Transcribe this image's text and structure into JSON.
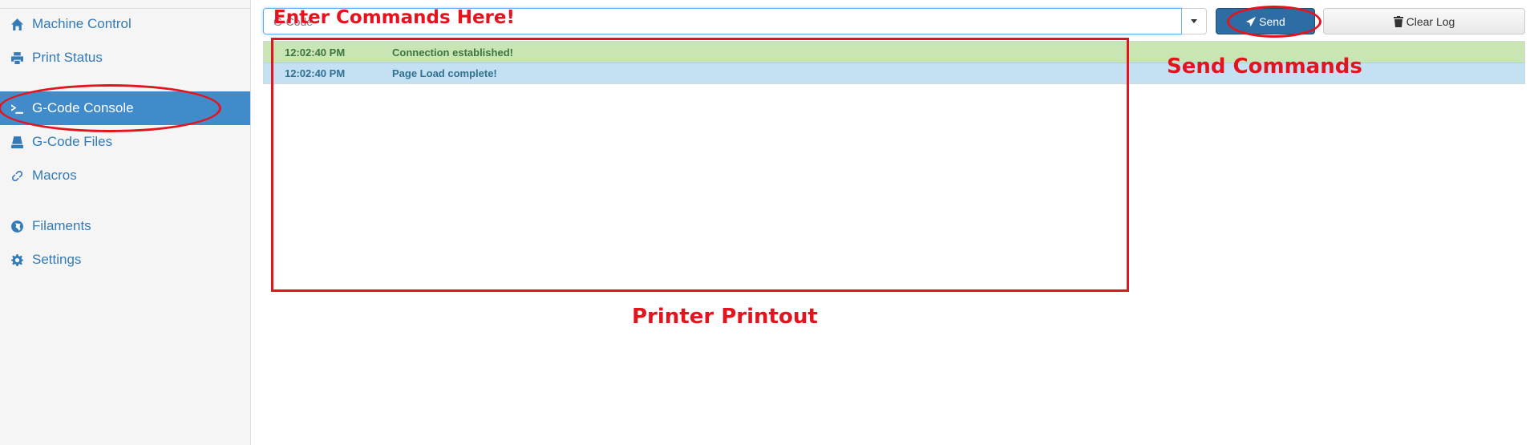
{
  "sidebar": {
    "items": [
      {
        "label": "Machine Control",
        "icon": "home-icon"
      },
      {
        "label": "Print Status",
        "icon": "printer-icon"
      },
      {
        "label": "G-Code Console",
        "icon": "terminal-icon",
        "active": true
      },
      {
        "label": "G-Code Files",
        "icon": "hdd-icon"
      },
      {
        "label": "Macros",
        "icon": "link-icon"
      },
      {
        "label": "Filaments",
        "icon": "globe-icon"
      },
      {
        "label": "Settings",
        "icon": "gear-icon"
      }
    ]
  },
  "toolbar": {
    "input_placeholder": "G-Code",
    "send_label": "Send",
    "clear_label": "Clear Log"
  },
  "log": [
    {
      "time": "12:02:40 PM",
      "message": "Connection established!",
      "type": "success"
    },
    {
      "time": "12:02:40 PM",
      "message": "Page Load complete!",
      "type": "info"
    }
  ],
  "annotations": {
    "enter_commands": "Enter Commands Here!",
    "send_commands": "Send Commands",
    "printer_printout": "Printer Printout",
    "color": "#e3141e"
  },
  "colors": {
    "active_nav": "#428bca",
    "link": "#337ab7",
    "send_button": "#2e6da4",
    "log_success": "#c9e5b4",
    "log_info": "#c3e1f3"
  }
}
